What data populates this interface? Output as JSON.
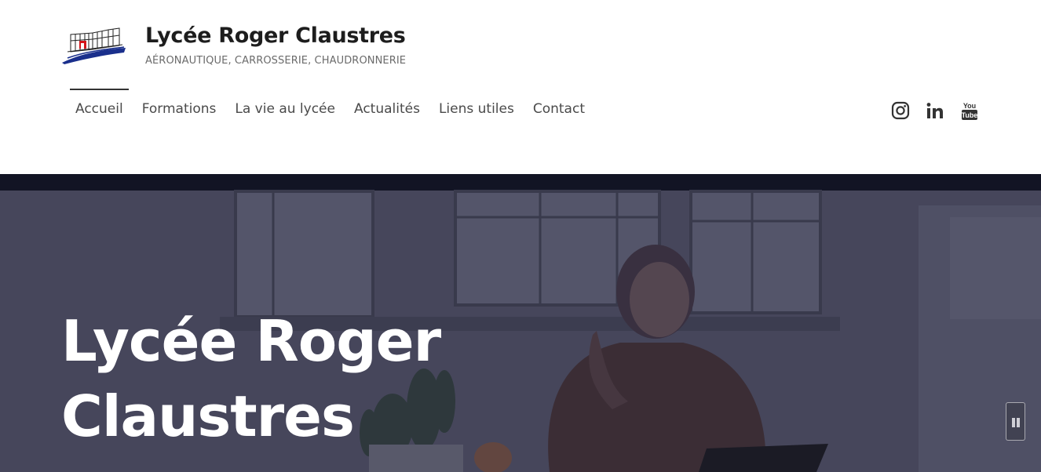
{
  "site": {
    "title": "Lycée Roger Claustres",
    "tagline": "AÉRONAUTIQUE, CARROSSERIE, CHAUDRONNERIE"
  },
  "nav": {
    "items": [
      {
        "label": "Accueil",
        "active": true
      },
      {
        "label": "Formations",
        "active": false
      },
      {
        "label": "La vie au lycée",
        "active": false
      },
      {
        "label": "Actualités",
        "active": false
      },
      {
        "label": "Liens utiles",
        "active": false
      },
      {
        "label": "Contact",
        "active": false
      }
    ]
  },
  "social": {
    "icons": [
      "instagram-icon",
      "linkedin-icon",
      "youtube-icon"
    ]
  },
  "hero": {
    "title": "Lycée Roger Claustres"
  },
  "video": {
    "state": "playing",
    "control_icon": "pause-icon"
  },
  "colors": {
    "title_text": "#1d1d1d",
    "tagline_text": "#6b6b6b",
    "nav_text": "#4a4a4a",
    "hero_overlay": "#45465a",
    "hero_top_band": "#0f1220",
    "logo_blue": "#1a2f8c",
    "logo_red": "#d4161b"
  }
}
